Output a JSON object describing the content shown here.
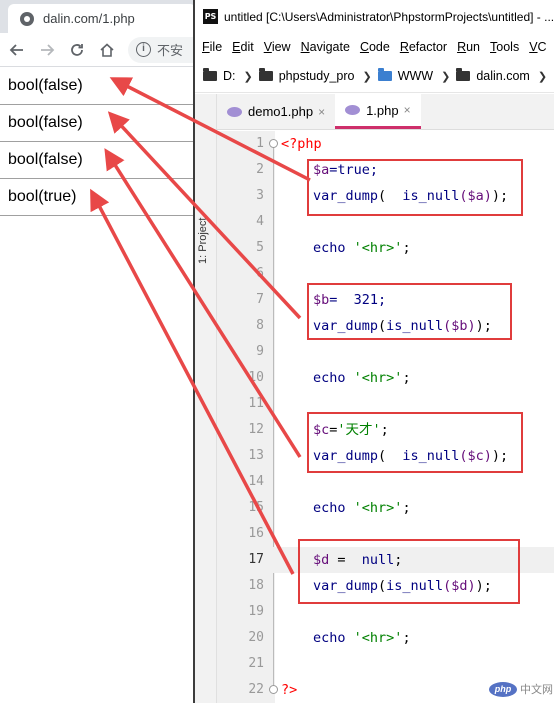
{
  "browser": {
    "tab_title": "dalin.com/1.php",
    "omnibox_text": "不安",
    "output_lines": [
      "bool(false)",
      "bool(false)",
      "bool(false)",
      "bool(true)"
    ]
  },
  "ide": {
    "title": "untitled [C:\\Users\\Administrator\\PhpstormProjects\\untitled] - ...",
    "logo": "PS",
    "menu": [
      {
        "u": "F",
        "rest": "ile"
      },
      {
        "u": "E",
        "rest": "dit"
      },
      {
        "u": "V",
        "rest": "iew"
      },
      {
        "u": "N",
        "rest": "avigate"
      },
      {
        "u": "C",
        "rest": "ode"
      },
      {
        "u": "R",
        "rest": "efactor"
      },
      {
        "u": "R",
        "rest": "un"
      },
      {
        "u": "T",
        "rest": "ools"
      },
      {
        "u": "V",
        "rest": "C"
      }
    ],
    "breadcrumbs": [
      "D:",
      "phpstudy_pro",
      "WWW",
      "dalin.com"
    ],
    "project_label": "1: Project",
    "tabs": [
      {
        "label": "demo1.php",
        "close": "×"
      },
      {
        "label": "1.php",
        "close": "×"
      }
    ],
    "line_numbers": [
      "1",
      "2",
      "3",
      "4",
      "5",
      "6",
      "7",
      "8",
      "9",
      "10",
      "11",
      "12",
      "13",
      "14",
      "15",
      "16",
      "17",
      "18",
      "19",
      "20",
      "21",
      "22"
    ],
    "code": {
      "l1": "<?php",
      "l2_var": "$a",
      "l2_rest": "=true;",
      "l3_fn": "var_dump",
      "l3_open": "(  ",
      "l3_fn2": "is_null",
      "l3_arg": "($a)",
      "l3_end": ");",
      "echo": "echo",
      "hr_str": "'<hr>'",
      "semi": ";",
      "l7_var": "$b",
      "l7_rest": "=  321;",
      "l8_fn": "var_dump",
      "l8_open": "(",
      "l8_fn2": "is_null",
      "l8_arg": "($b)",
      "l8_end": ");",
      "l12_var": "$c",
      "l12_eq": "=",
      "l12_str": "'天才'",
      "l12_semi": ";",
      "l13_fn": "var_dump",
      "l13_open": "(  ",
      "l13_fn2": "is_null",
      "l13_arg": "($c)",
      "l13_end": ");",
      "l17_var": "$d",
      "l17_eq": " =  ",
      "l17_kw": "null",
      "l17_semi": ";",
      "l18_fn": "var_dump",
      "l18_open": "(",
      "l18_fn2": "is_null",
      "l18_arg": "($d)",
      "l18_end": ");",
      "l22": "?>"
    }
  },
  "watermark": {
    "logo": "php",
    "text": "中文网"
  },
  "colors": {
    "annotation": "#e03c3c",
    "active_tab": "#ce2f6b"
  }
}
